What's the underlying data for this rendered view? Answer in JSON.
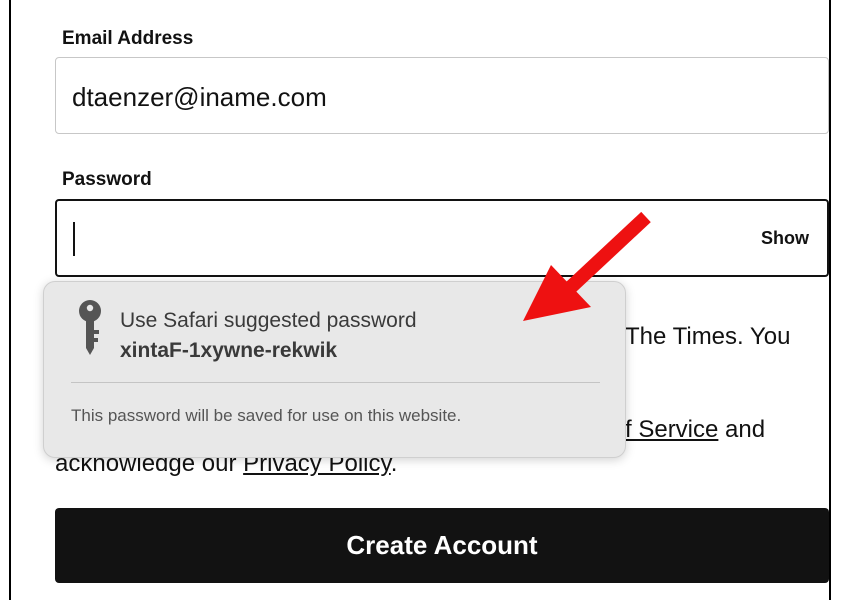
{
  "form": {
    "email_label": "Email Address",
    "email_value": "dtaenzer@iname.com",
    "password_label": "Password",
    "password_value": "",
    "show_label": "Show",
    "legal_line1_partial": "The Times. You",
    "legal_terms_link_partial": "f Service",
    "legal_and": " and",
    "legal_line3_prefix": "acknowledge our ",
    "privacy_link": "Privacy Policy",
    "legal_line3_suffix": ".",
    "submit_label": "Create Account"
  },
  "safari_popup": {
    "title": "Use Safari suggested password",
    "suggested_password": "xintaF-1xywne-rekwik",
    "note": "This password will be saved for use on this website.",
    "icon": "key-icon"
  },
  "annotation": {
    "arrow_color": "#ee1111",
    "icon": "red-arrow-icon"
  },
  "colors": {
    "text": "#121212",
    "button_bg": "#121212",
    "button_text": "#ffffff",
    "popup_bg": "#e8e8e8",
    "input_border": "#c7c7c7"
  }
}
